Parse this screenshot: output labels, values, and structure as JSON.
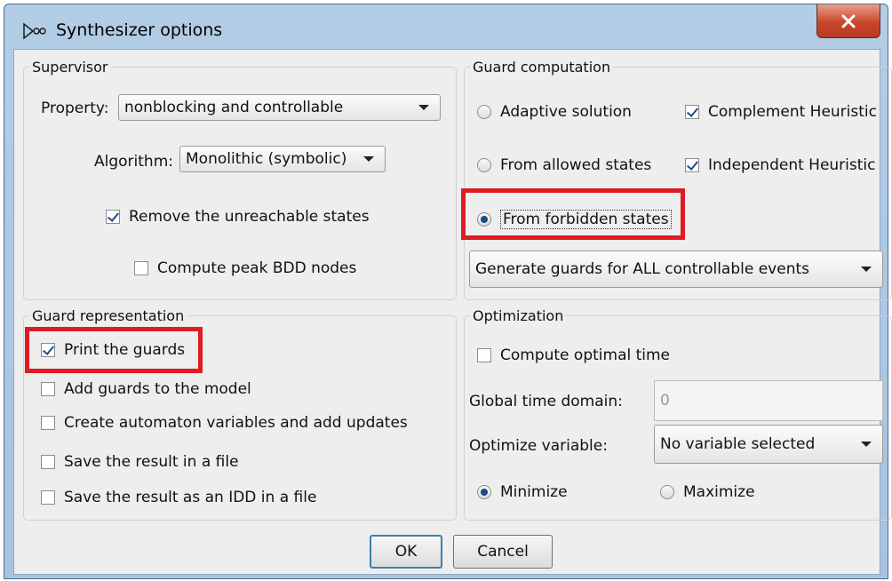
{
  "window": {
    "title": "Synthesizer options",
    "close_label": "x"
  },
  "supervisor": {
    "legend": "Supervisor",
    "property_label": "Property:",
    "property_value": "nonblocking and controllable",
    "algorithm_label": "Algorithm:",
    "algorithm_value": "Monolithic (symbolic)",
    "remove_unreachable": {
      "label": "Remove the unreachable states",
      "checked": true
    },
    "compute_peak": {
      "label": "Compute peak BDD nodes",
      "checked": false
    }
  },
  "guard_computation": {
    "legend": "Guard computation",
    "options": [
      {
        "label": "Adaptive solution",
        "selected": false
      },
      {
        "label": "From allowed states",
        "selected": false
      },
      {
        "label": "From forbidden states",
        "selected": true
      }
    ],
    "complement_heuristic": {
      "label": "Complement Heuristic",
      "checked": true
    },
    "independent_heuristic": {
      "label": "Independent Heuristic",
      "checked": true
    },
    "events_value": "Generate guards for ALL controllable events"
  },
  "guard_representation": {
    "legend": "Guard representation",
    "items": [
      {
        "label": "Print the guards",
        "checked": true
      },
      {
        "label": "Add guards to the model",
        "checked": false
      },
      {
        "label": "Create automaton variables and add updates",
        "checked": false
      },
      {
        "label": "Save the result in a file",
        "checked": false
      },
      {
        "label": "Save the result as an IDD in a file",
        "checked": false
      }
    ]
  },
  "optimization": {
    "legend": "Optimization",
    "compute_optimal_time": {
      "label": "Compute optimal time",
      "checked": false
    },
    "global_time_label": "Global time domain:",
    "global_time_value": "0",
    "optimize_variable_label": "Optimize variable:",
    "optimize_variable_value": "No variable selected",
    "minimize_label": "Minimize",
    "maximize_label": "Maximize",
    "selected": "Minimize"
  },
  "buttons": {
    "ok": "OK",
    "cancel": "Cancel"
  },
  "colors": {
    "highlight": "#e01b24",
    "title_bar": "#b3cde6",
    "panel": "#eeeeee"
  }
}
